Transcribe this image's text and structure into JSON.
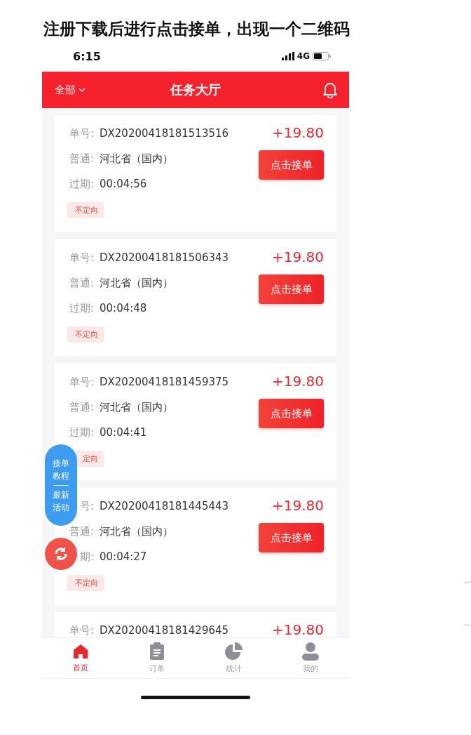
{
  "caption": "注册下载后进行点击接单，出现一个二维码",
  "status_bar": {
    "time": "6:15",
    "network": "4G"
  },
  "header": {
    "filter": "全部",
    "title": "任务大厅"
  },
  "cards": [
    {
      "order_label": "单号:",
      "order_no": "DX20200418181513516",
      "price": "+19.80",
      "region_label": "普通:",
      "region": "河北省（国内）",
      "expiry_label": "过期:",
      "expiry": "00:04:56",
      "tag": "不定向",
      "button": "点击接单"
    },
    {
      "order_label": "单号:",
      "order_no": "DX20200418181506343",
      "price": "+19.80",
      "region_label": "普通:",
      "region": "河北省（国内）",
      "expiry_label": "过期:",
      "expiry": "00:04:48",
      "tag": "不定向",
      "button": "点击接单"
    },
    {
      "order_label": "单号:",
      "order_no": "DX20200418181459375",
      "price": "+19.80",
      "region_label": "普通:",
      "region": "河北省（国内）",
      "expiry_label": "过期:",
      "expiry": "00:04:41",
      "tag": "定向",
      "button": "点击接单"
    },
    {
      "order_label": "号:",
      "order_no": "DX20200418181445443",
      "price": "+19.80",
      "region_label": "普通:",
      "region": "河北省（国内）",
      "expiry_label": "期:",
      "expiry": "00:04:27",
      "tag": "不定向",
      "button": "点击接单"
    },
    {
      "order_label": "单号:",
      "order_no": "DX20200418181429645",
      "price": "+19.80"
    }
  ],
  "float_menu": {
    "top": "接单教程",
    "bottom": "最新活动"
  },
  "tabs": [
    {
      "label": "首页",
      "selected": true
    },
    {
      "label": "订单",
      "selected": false
    },
    {
      "label": "统计",
      "selected": false
    },
    {
      "label": "我的",
      "selected": false
    }
  ]
}
